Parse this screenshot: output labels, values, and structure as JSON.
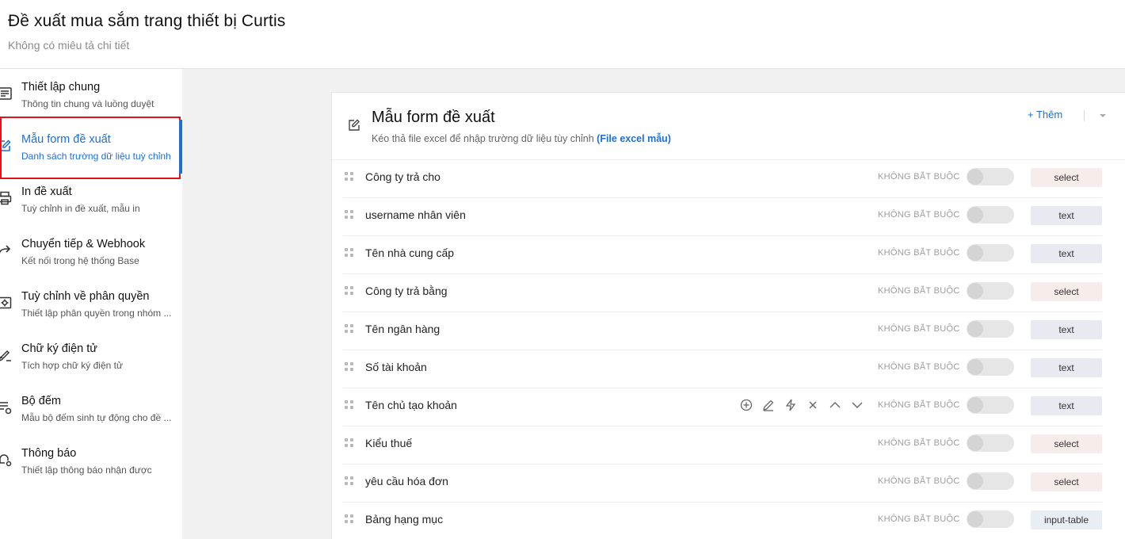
{
  "header": {
    "title": "Đề xuất mua sắm trang thiết bị Curtis",
    "subtitle": "Không có miêu tả chi tiết"
  },
  "sidebar": {
    "items": [
      {
        "title": "Thiết lập chung",
        "desc": "Thông tin chung và luồng duyệt",
        "icon": "document-list-icon"
      },
      {
        "title": "Mẫu form đề xuất",
        "desc": "Danh sách trường dữ liệu tuỳ chỉnh",
        "icon": "edit-icon",
        "active": true
      },
      {
        "title": "In đề xuất",
        "desc": "Tuỳ chỉnh in đề xuất, mẫu in",
        "icon": "printer-icon"
      },
      {
        "title": "Chuyển tiếp & Webhook",
        "desc": "Kết nối trong hệ thống Base",
        "icon": "share-forward-icon"
      },
      {
        "title": "Tuỳ chỉnh về phân quyền",
        "desc": "Thiết lập phân quyền trong nhóm ...",
        "icon": "settings-box-icon"
      },
      {
        "title": "Chữ ký điện tử",
        "desc": "Tích hợp chữ ký điện tử",
        "icon": "signature-icon"
      },
      {
        "title": "Bộ đếm",
        "desc": "Mẫu bộ đếm sinh tự động cho đề ...",
        "icon": "counter-settings-icon"
      },
      {
        "title": "Thông báo",
        "desc": "Thiết lập thông báo nhận được",
        "icon": "notification-settings-icon"
      }
    ]
  },
  "form": {
    "title": "Mẫu form đề xuất",
    "subtitle_text": "Kéo thả file excel để nhập trường dữ liệu tùy chỉnh",
    "subtitle_link": "(File excel mẫu)",
    "add_button": "+ Thêm",
    "fields": [
      {
        "label": "Công ty trả cho",
        "required": "KHÔNG BẮT BUỘC",
        "type": "select",
        "enabled": false
      },
      {
        "label": "username nhân viên",
        "required": "KHÔNG BẮT BUỘC",
        "type": "text",
        "enabled": false
      },
      {
        "label": "Tên nhà cung cấp",
        "required": "KHÔNG BẮT BUỘC",
        "type": "text",
        "enabled": false
      },
      {
        "label": "Công ty trả bằng",
        "required": "KHÔNG BẮT BUỘC",
        "type": "select",
        "enabled": false
      },
      {
        "label": "Tên ngân hàng",
        "required": "KHÔNG BẮT BUỘC",
        "type": "text",
        "enabled": false
      },
      {
        "label": "Số tài khoản",
        "required": "KHÔNG BẮT BUỘC",
        "type": "text",
        "enabled": false
      },
      {
        "label": "Tên chủ tạo khoản",
        "required": "KHÔNG BẮT BUỘC",
        "type": "text",
        "enabled": false,
        "show_actions": true
      },
      {
        "label": "Kiểu thuế",
        "required": "KHÔNG BẮT BUỘC",
        "type": "select",
        "enabled": false
      },
      {
        "label": "yêu cầu hóa đơn",
        "required": "KHÔNG BẮT BUỘC",
        "type": "select",
        "enabled": false
      },
      {
        "label": "Bảng hạng mục",
        "required": "KHÔNG BẮT BUỘC",
        "type": "input-table",
        "enabled": false
      }
    ]
  },
  "colors": {
    "accent": "#1f6fd1",
    "highlight_border": "#e0151b",
    "content_bg": "#f1f1f1"
  }
}
